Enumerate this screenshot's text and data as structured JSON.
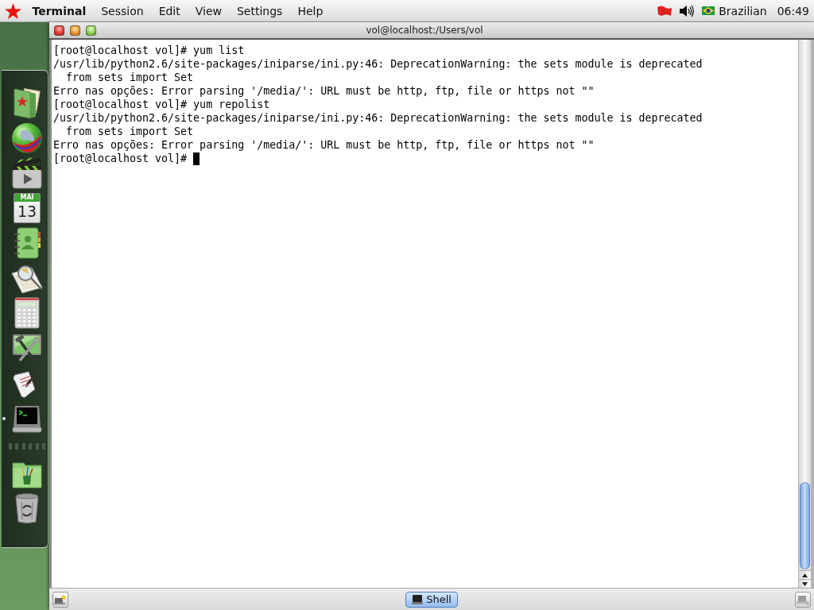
{
  "menu_bar": {
    "app_name": "Terminal",
    "menus": [
      "Session",
      "Edit",
      "View",
      "Settings",
      "Help"
    ],
    "keyboard_layout": "Brazilian",
    "clock": "06:49"
  },
  "dock": {
    "launchers": [
      {
        "running": false
      },
      {
        "running": false
      },
      {
        "running": false
      },
      {
        "running": false,
        "month": "MAI",
        "day": "13"
      },
      {
        "running": false
      },
      {
        "running": false
      },
      {
        "running": false
      },
      {
        "running": false
      },
      {
        "running": false
      },
      {
        "running": true
      }
    ],
    "stacks": [
      {
        "running": false
      },
      {
        "running": false
      }
    ]
  },
  "window": {
    "title": "vol@localhost:/Users/vol",
    "lines": [
      "[root@localhost vol]# yum list",
      "/usr/lib/python2.6/site-packages/iniparse/ini.py:46: DeprecationWarning: the sets module is deprecated",
      "  from sets import Set",
      "Erro nas opções: Error parsing '/media/': URL must be http, ftp, file or https not \"\"",
      "[root@localhost vol]# yum repolist",
      "/usr/lib/python2.6/site-packages/iniparse/ini.py:46: DeprecationWarning: the sets module is deprecated",
      "  from sets import Set",
      "Erro nas opções: Error parsing '/media/': URL must be http, ftp, file or https not \"\"",
      "[root@localhost vol]#"
    ]
  },
  "tab_bar": {
    "tabs": [
      {
        "label": "Shell",
        "selected": true
      }
    ]
  }
}
